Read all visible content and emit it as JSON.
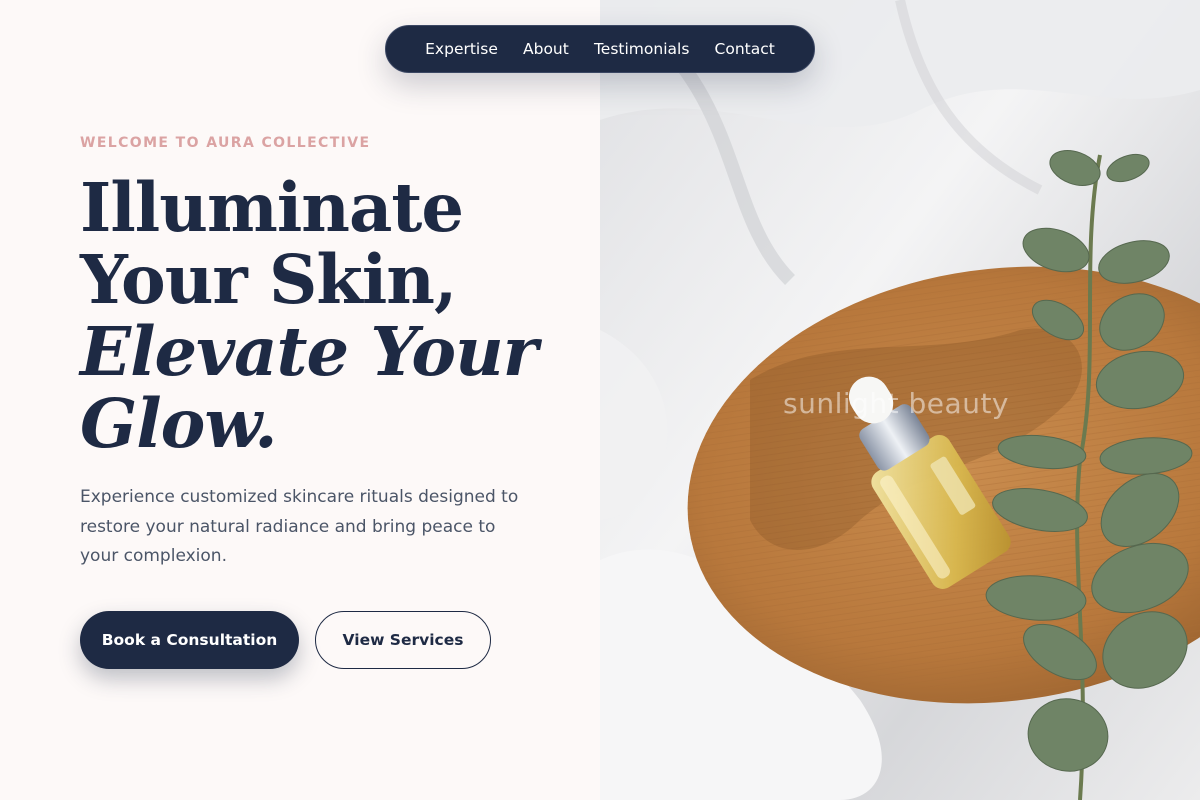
{
  "nav": {
    "items": [
      {
        "label": "Expertise"
      },
      {
        "label": "About"
      },
      {
        "label": "Testimonials"
      },
      {
        "label": "Contact"
      }
    ]
  },
  "hero": {
    "eyebrow": "WELCOME TO AURA COLLECTIVE",
    "headline": {
      "line1": "Illuminate",
      "line2": "Your Skin,",
      "line3": "Elevate Your",
      "line4": "Glow."
    },
    "description": "Experience customized skincare rituals designed to restore your natural radiance and bring peace to your complexion.",
    "primary_button": "Book a Consultation",
    "secondary_button": "View Services"
  },
  "image": {
    "watermark": "sunlight beauty"
  },
  "colors": {
    "navy": "#1e2a44",
    "rose_accent": "#dba3a3",
    "background": "#fdf9f8"
  }
}
